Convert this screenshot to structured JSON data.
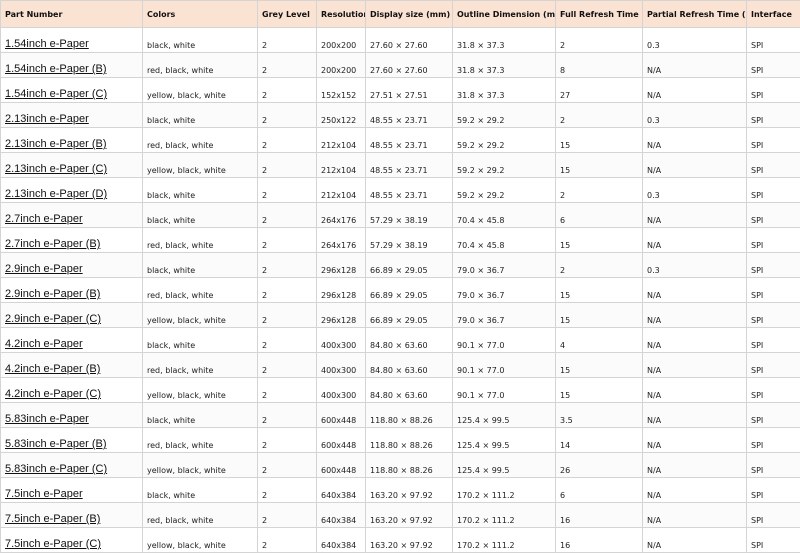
{
  "columns": [
    "Part Number",
    "Colors",
    "Grey Level",
    "Resolution",
    "Display size (mm)",
    "Outline Dimension (mm)",
    "Full Refresh Time (s)",
    "Partial Refresh Time (s)",
    "Interface"
  ],
  "rows": [
    [
      "1.54inch e-Paper",
      "black, white",
      "2",
      "200x200",
      "27.60 × 27.60",
      "31.8 × 37.3",
      "2",
      "0.3",
      "SPI"
    ],
    [
      "1.54inch e-Paper (B)",
      "red, black, white",
      "2",
      "200x200",
      "27.60 × 27.60",
      "31.8 × 37.3",
      "8",
      "N/A",
      "SPI"
    ],
    [
      "1.54inch e-Paper (C)",
      "yellow, black, white",
      "2",
      "152x152",
      "27.51 × 27.51",
      "31.8 × 37.3",
      "27",
      "N/A",
      "SPI"
    ],
    [
      "2.13inch e-Paper",
      "black, white",
      "2",
      "250x122",
      "48.55 × 23.71",
      "59.2 × 29.2",
      "2",
      "0.3",
      "SPI"
    ],
    [
      "2.13inch e-Paper (B)",
      "red, black, white",
      "2",
      "212x104",
      "48.55 × 23.71",
      "59.2 × 29.2",
      "15",
      "N/A",
      "SPI"
    ],
    [
      "2.13inch e-Paper (C)",
      "yellow, black, white",
      "2",
      "212x104",
      "48.55 × 23.71",
      "59.2 × 29.2",
      "15",
      "N/A",
      "SPI"
    ],
    [
      "2.13inch e-Paper (D)",
      "black, white",
      "2",
      "212x104",
      "48.55 × 23.71",
      "59.2 × 29.2",
      "2",
      "0.3",
      "SPI"
    ],
    [
      "2.7inch e-Paper",
      "black, white",
      "2",
      "264x176",
      "57.29 × 38.19",
      "70.4 × 45.8",
      "6",
      "N/A",
      "SPI"
    ],
    [
      "2.7inch e-Paper (B)",
      "red, black, white",
      "2",
      "264x176",
      "57.29 × 38.19",
      "70.4 × 45.8",
      "15",
      "N/A",
      "SPI"
    ],
    [
      "2.9inch e-Paper",
      "black, white",
      "2",
      "296x128",
      "66.89 × 29.05",
      "79.0 × 36.7",
      "2",
      "0.3",
      "SPI"
    ],
    [
      "2.9inch e-Paper (B)",
      "red, black, white",
      "2",
      "296x128",
      "66.89 × 29.05",
      "79.0 × 36.7",
      "15",
      "N/A",
      "SPI"
    ],
    [
      "2.9inch e-Paper (C)",
      "yellow, black, white",
      "2",
      "296x128",
      "66.89 × 29.05",
      "79.0 × 36.7",
      "15",
      "N/A",
      "SPI"
    ],
    [
      "4.2inch e-Paper",
      "black, white",
      "2",
      "400x300",
      "84.80 × 63.60",
      "90.1 × 77.0",
      "4",
      "N/A",
      "SPI"
    ],
    [
      "4.2inch e-Paper (B)",
      "red, black, white",
      "2",
      "400x300",
      "84.80 × 63.60",
      "90.1 × 77.0",
      "15",
      "N/A",
      "SPI"
    ],
    [
      "4.2inch e-Paper (C)",
      "yellow, black, white",
      "2",
      "400x300",
      "84.80 × 63.60",
      "90.1 × 77.0",
      "15",
      "N/A",
      "SPI"
    ],
    [
      "5.83inch e-Paper",
      "black, white",
      "2",
      "600x448",
      "118.80 × 88.26",
      "125.4 × 99.5",
      "3.5",
      "N/A",
      "SPI"
    ],
    [
      "5.83inch e-Paper (B)",
      "red, black, white",
      "2",
      "600x448",
      "118.80 × 88.26",
      "125.4 × 99.5",
      "14",
      "N/A",
      "SPI"
    ],
    [
      "5.83inch e-Paper (C)",
      "yellow, black, white",
      "2",
      "600x448",
      "118.80 × 88.26",
      "125.4 × 99.5",
      "26",
      "N/A",
      "SPI"
    ],
    [
      "7.5inch e-Paper",
      "black, white",
      "2",
      "640x384",
      "163.20 × 97.92",
      "170.2 × 111.2",
      "6",
      "N/A",
      "SPI"
    ],
    [
      "7.5inch e-Paper (B)",
      "red, black, white",
      "2",
      "640x384",
      "163.20 × 97.92",
      "170.2 × 111.2",
      "16",
      "N/A",
      "SPI"
    ],
    [
      "7.5inch e-Paper (C)",
      "yellow, black, white",
      "2",
      "640x384",
      "163.20 × 97.92",
      "170.2 × 111.2",
      "16",
      "N/A",
      "SPI"
    ]
  ],
  "colors": {
    "header_background": "#fbe3d4",
    "grid_line": "#d4d4d4"
  }
}
